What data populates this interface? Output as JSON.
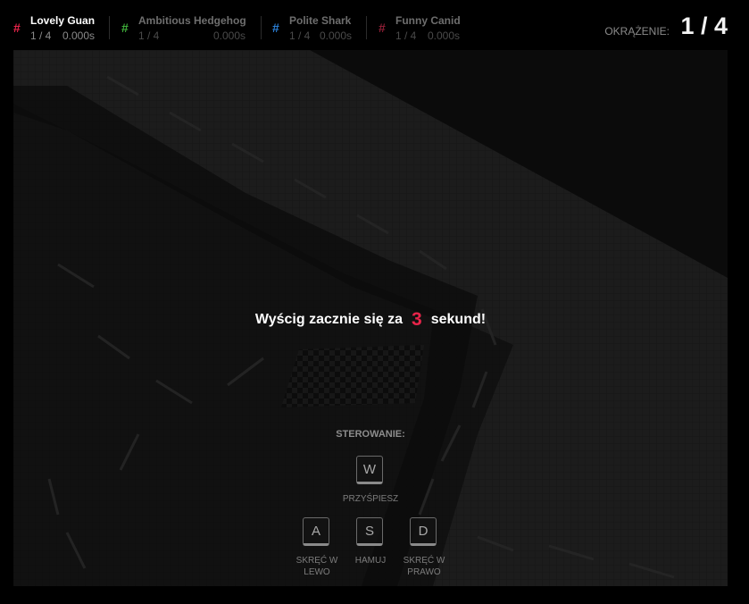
{
  "players": [
    {
      "name": "Lovely Guan",
      "lap": "1 / 4",
      "time": "0.000s",
      "color": "#e8244a",
      "highlight": true
    },
    {
      "name": "Ambitious Hedgehog",
      "lap": "1 / 4",
      "time": "0.000s",
      "color": "#3fae3a",
      "highlight": false
    },
    {
      "name": "Polite Shark",
      "lap": "1 / 4",
      "time": "0.000s",
      "color": "#2b7fd6",
      "highlight": false
    },
    {
      "name": "Funny Canid",
      "lap": "1 / 4",
      "time": "0.000s",
      "color": "#8c1e34",
      "highlight": false
    }
  ],
  "hash_symbol": "#",
  "lap_counter": {
    "label": "OKRĄŻENIE:",
    "value": "1 / 4"
  },
  "countdown": {
    "prefix": "Wyścig zacznie się za",
    "number": "3",
    "suffix": "sekund!"
  },
  "controls": {
    "title": "STEROWANIE:",
    "keys": {
      "w": {
        "key": "W",
        "label": "PRZYŚPIESZ"
      },
      "a": {
        "key": "A",
        "label_line1": "SKRĘĆ W",
        "label_line2": "LEWO"
      },
      "s": {
        "key": "S",
        "label": "HAMUJ"
      },
      "d": {
        "key": "D",
        "label_line1": "SKRĘĆ W",
        "label_line2": "PRAWO"
      }
    }
  }
}
